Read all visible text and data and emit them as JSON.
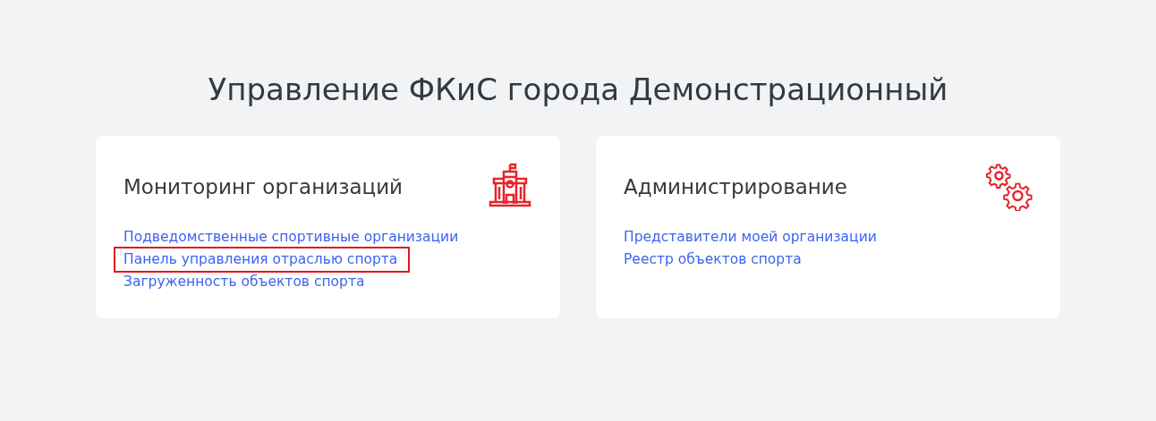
{
  "page_title": "Управление ФКиС города Демонстрационный",
  "cards": [
    {
      "title": "Мониторинг организаций",
      "links": [
        {
          "label": "Подведомственные спортивные организации",
          "highlighted": false
        },
        {
          "label": "Панель управления отраслью спорта",
          "highlighted": true
        },
        {
          "label": "Загруженность объектов спорта",
          "highlighted": false
        }
      ]
    },
    {
      "title": "Администрирование",
      "links": [
        {
          "label": "Представители моей организации",
          "highlighted": false
        },
        {
          "label": "Реестр объектов спорта",
          "highlighted": false
        }
      ]
    }
  ]
}
